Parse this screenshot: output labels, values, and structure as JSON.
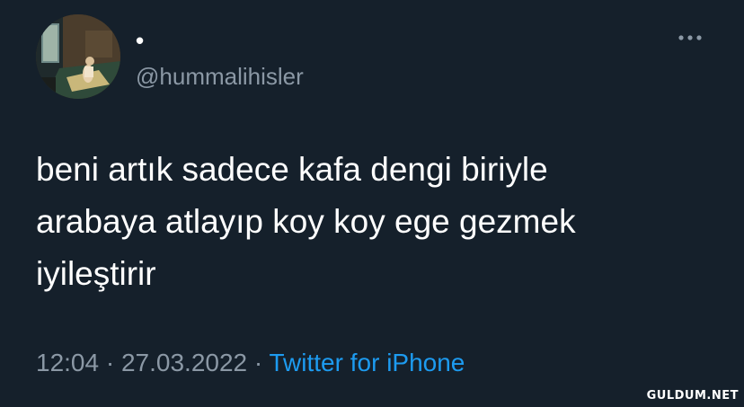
{
  "tweet": {
    "display_name": "•",
    "handle": "@hummalihisler",
    "text": "beni artık sadece kafa dengi biriyle\narabaya atlayıp koy koy ege gezmek\niyileştirir",
    "time": "12:04",
    "separator": "·",
    "date": "27.03.2022",
    "source": "Twitter for iPhone",
    "more_icon": "more-horizontal-icon"
  },
  "watermark": "GULDUM.NET",
  "colors": {
    "background": "#15202b",
    "text": "#ffffff",
    "secondary": "#8b98a5",
    "link": "#1d9bf0"
  }
}
